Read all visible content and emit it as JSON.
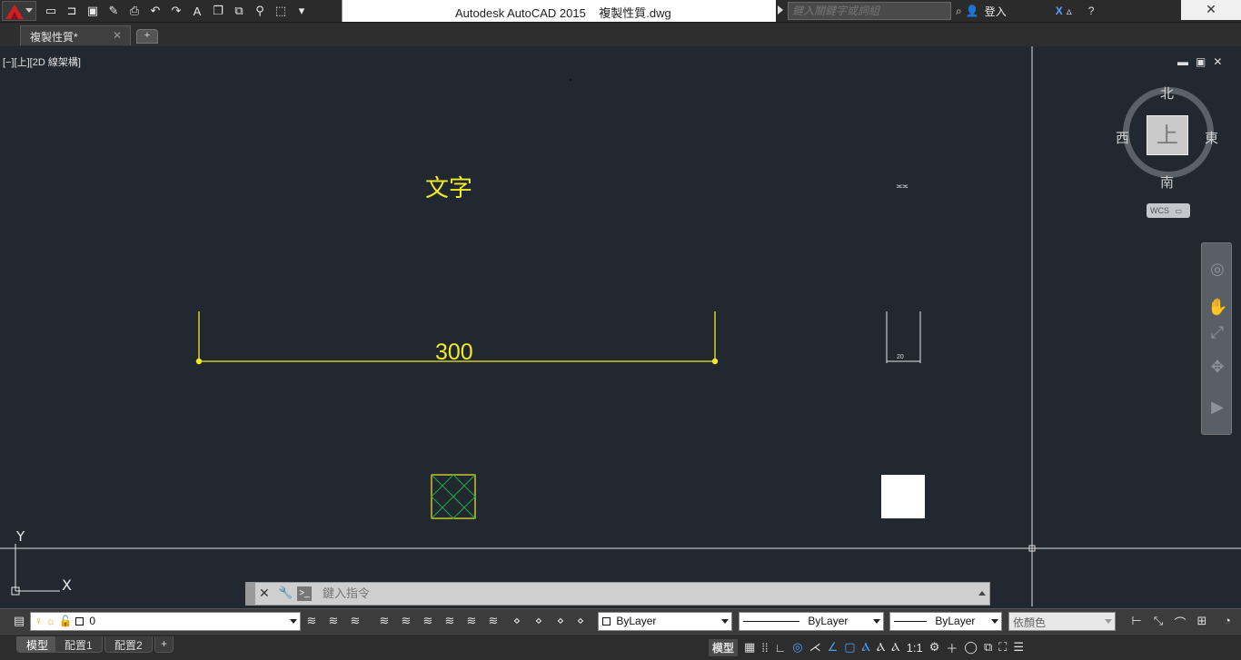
{
  "titlebar": {
    "title": "Autodesk AutoCAD 2015    複製性質.dwg",
    "search_placeholder": "鍵入關鍵字或詞組",
    "signin_label": "登入",
    "close_symbol": "✕",
    "qat_icons": [
      "new-icon",
      "open-icon",
      "save-icon",
      "save-as-icon",
      "plot-icon",
      "undo-icon",
      "redo-icon",
      "text-icon",
      "copy-icon",
      "match-icon",
      "zoom-icon",
      "select-icon",
      "customize-icon"
    ]
  },
  "tabs": {
    "file_tab_label": "複製性質*",
    "file_tab_close": "✕",
    "new_tab_symbol": "+"
  },
  "viewport": {
    "label": "[−][上][2D 線架構]",
    "minimize": "▬",
    "restore": "▣",
    "close": "✕"
  },
  "drawing": {
    "text_entity": "文字",
    "dimension_text": "300",
    "small_dimension_text": "20",
    "dim_symbol": "≍≍",
    "ucs_x": "X",
    "ucs_y": "Y",
    "colors": {
      "background": "#212830",
      "yellow": "#f2ea27",
      "green_hatch": "#1fa64a",
      "white": "#ffffff"
    }
  },
  "viewcube": {
    "north": "北",
    "south": "南",
    "east": "東",
    "west": "西",
    "face": "上",
    "wcs": "WCS"
  },
  "navbar": {
    "icons": [
      "steering-wheel-icon",
      "pan-icon",
      "zoom-extents-icon",
      "orbit-icon",
      "showmotion-icon"
    ]
  },
  "command_line": {
    "placeholder": "鍵入指令",
    "close_symbol": "✕",
    "tool_symbol": "🔧",
    "prompt_symbol": ">_"
  },
  "layer_toolbar": {
    "layer_name": "0",
    "color_value": "ByLayer",
    "linetype_value": "ByLayer",
    "lineweight_value": "ByLayer",
    "plotstyle_value": "依顏色"
  },
  "statusbar": {
    "tab_model": "模型",
    "tab_layout1": "配置1",
    "tab_layout2": "配置2",
    "tab_add": "+",
    "model_label": "模型",
    "scale_label": "1:1"
  }
}
